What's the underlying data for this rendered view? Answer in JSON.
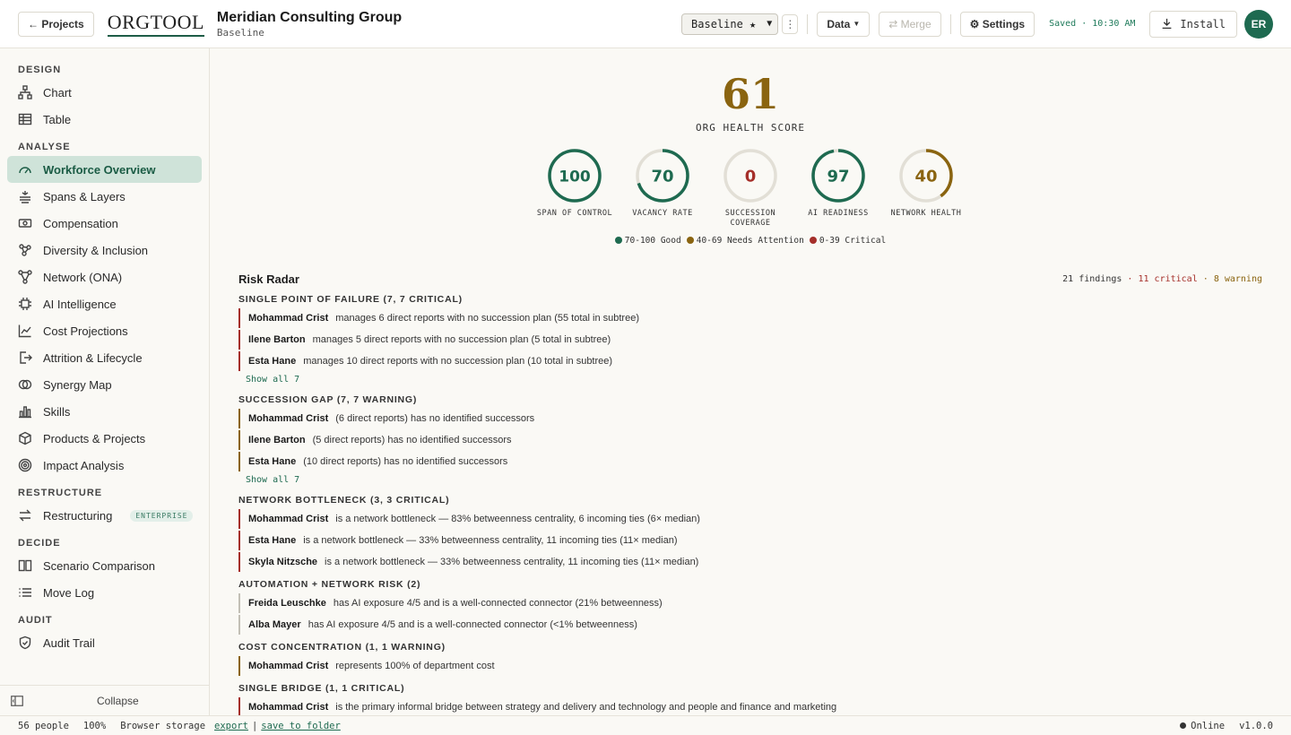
{
  "header": {
    "back_label": "← Projects",
    "logo": "ORGTOOL",
    "company_name": "Meridian Consulting Group",
    "scenario_sub": "Baseline",
    "scenario_select": "Baseline ★",
    "data_label": "Data",
    "merge_label": "⇄ Merge",
    "settings_label": "⚙ Settings",
    "saved": "Saved · 10:30 AM",
    "install_label": "Install",
    "avatar": "ER"
  },
  "sidebar": {
    "sections": [
      {
        "title": "DESIGN",
        "items": [
          {
            "label": "Chart",
            "icon": "org-chart-icon"
          },
          {
            "label": "Table",
            "icon": "table-icon"
          }
        ]
      },
      {
        "title": "ANALYSE",
        "items": [
          {
            "label": "Workforce Overview",
            "icon": "gauge-icon",
            "active": true
          },
          {
            "label": "Spans & Layers",
            "icon": "layers-icon"
          },
          {
            "label": "Compensation",
            "icon": "banknote-icon"
          },
          {
            "label": "Diversity & Inclusion",
            "icon": "nodes-icon"
          },
          {
            "label": "Network (ONA)",
            "icon": "network-icon"
          },
          {
            "label": "AI Intelligence",
            "icon": "chip-icon"
          },
          {
            "label": "Cost Projections",
            "icon": "line-chart-icon"
          },
          {
            "label": "Attrition & Lifecycle",
            "icon": "exit-icon"
          },
          {
            "label": "Synergy Map",
            "icon": "overlap-circles-icon"
          },
          {
            "label": "Skills",
            "icon": "bar-chart-icon"
          },
          {
            "label": "Products & Projects",
            "icon": "box-icon"
          },
          {
            "label": "Impact Analysis",
            "icon": "target-icon"
          }
        ]
      },
      {
        "title": "RESTRUCTURE",
        "items": [
          {
            "label": "Restructuring",
            "icon": "swap-icon",
            "badge": "ENTERPRISE"
          }
        ]
      },
      {
        "title": "DECIDE",
        "items": [
          {
            "label": "Scenario Comparison",
            "icon": "columns-icon"
          },
          {
            "label": "Move Log",
            "icon": "list-icon"
          }
        ]
      },
      {
        "title": "AUDIT",
        "items": [
          {
            "label": "Audit Trail",
            "icon": "shield-check-icon"
          }
        ]
      }
    ],
    "collapse_label": "Collapse"
  },
  "overview": {
    "score": "61",
    "score_label": "ORG HEALTH SCORE",
    "metrics": [
      {
        "value": 100,
        "label": "SPAN OF CONTROL",
        "color": "#1e6a50"
      },
      {
        "value": 70,
        "label": "VACANCY RATE",
        "color": "#1e6a50"
      },
      {
        "value": 0,
        "label": "SUCCESSION COVERAGE",
        "color": "#a52f2a"
      },
      {
        "value": 97,
        "label": "AI READINESS",
        "color": "#1e6a50"
      },
      {
        "value": 40,
        "label": "NETWORK HEALTH",
        "color": "#8a6410"
      }
    ],
    "legend": [
      {
        "label": "70-100 Good",
        "color": "#1e6a50"
      },
      {
        "label": "40-69 Needs Attention",
        "color": "#8a6410"
      },
      {
        "label": "0-39 Critical",
        "color": "#a52f2a"
      }
    ]
  },
  "radar": {
    "title": "Risk Radar",
    "findings": "21 findings",
    "critical": "11 critical",
    "warning": "8 warning",
    "categories": [
      {
        "title": "SINGLE POINT OF FAILURE (7, 7 CRITICAL)",
        "severity": "critical",
        "show_all": "Show all 7",
        "rows": [
          {
            "name": "Mohammad Crist",
            "text": "manages 6 direct reports with no succession plan (55 total in subtree)"
          },
          {
            "name": "Ilene Barton",
            "text": "manages 5 direct reports with no succession plan (5 total in subtree)"
          },
          {
            "name": "Esta Hane",
            "text": "manages 10 direct reports with no succession plan (10 total in subtree)"
          }
        ]
      },
      {
        "title": "SUCCESSION GAP (7, 7 WARNING)",
        "severity": "warning",
        "show_all": "Show all 7",
        "rows": [
          {
            "name": "Mohammad Crist",
            "text": "(6 direct reports) has no identified successors"
          },
          {
            "name": "Ilene Barton",
            "text": "(5 direct reports) has no identified successors"
          },
          {
            "name": "Esta Hane",
            "text": "(10 direct reports) has no identified successors"
          }
        ]
      },
      {
        "title": "NETWORK BOTTLENECK (3, 3 CRITICAL)",
        "severity": "critical",
        "show_all": "",
        "rows": [
          {
            "name": "Mohammad Crist",
            "text": "is a network bottleneck — 83% betweenness centrality, 6 incoming ties (6× median)"
          },
          {
            "name": "Esta Hane",
            "text": "is a network bottleneck — 33% betweenness centrality, 11 incoming ties (11× median)"
          },
          {
            "name": "Skyla Nitzsche",
            "text": "is a network bottleneck — 33% betweenness centrality, 11 incoming ties (11× median)"
          }
        ]
      },
      {
        "title": "AUTOMATION + NETWORK RISK (2)",
        "severity": "info",
        "show_all": "",
        "rows": [
          {
            "name": "Freida Leuschke",
            "text": "has AI exposure 4/5 and is a well-connected connector (21% betweenness)"
          },
          {
            "name": "Alba Mayer",
            "text": "has AI exposure 4/5 and is a well-connected connector (<1% betweenness)"
          }
        ]
      },
      {
        "title": "COST CONCENTRATION (1, 1 WARNING)",
        "severity": "warning",
        "show_all": "",
        "rows": [
          {
            "name": "Mohammad Crist",
            "text": "represents 100% of department cost"
          }
        ]
      },
      {
        "title": "SINGLE BRIDGE (1, 1 CRITICAL)",
        "severity": "critical",
        "show_all": "",
        "rows": [
          {
            "name": "Mohammad Crist",
            "text": "is the primary informal bridge between strategy and delivery and technology and people and finance and marketing"
          }
        ]
      }
    ]
  },
  "status": {
    "people": "56 people",
    "zoom": "100%",
    "storage": "Browser storage",
    "export": "export",
    "sep": "|",
    "save": "save to folder",
    "online": "Online",
    "version": "v1.0.0"
  }
}
